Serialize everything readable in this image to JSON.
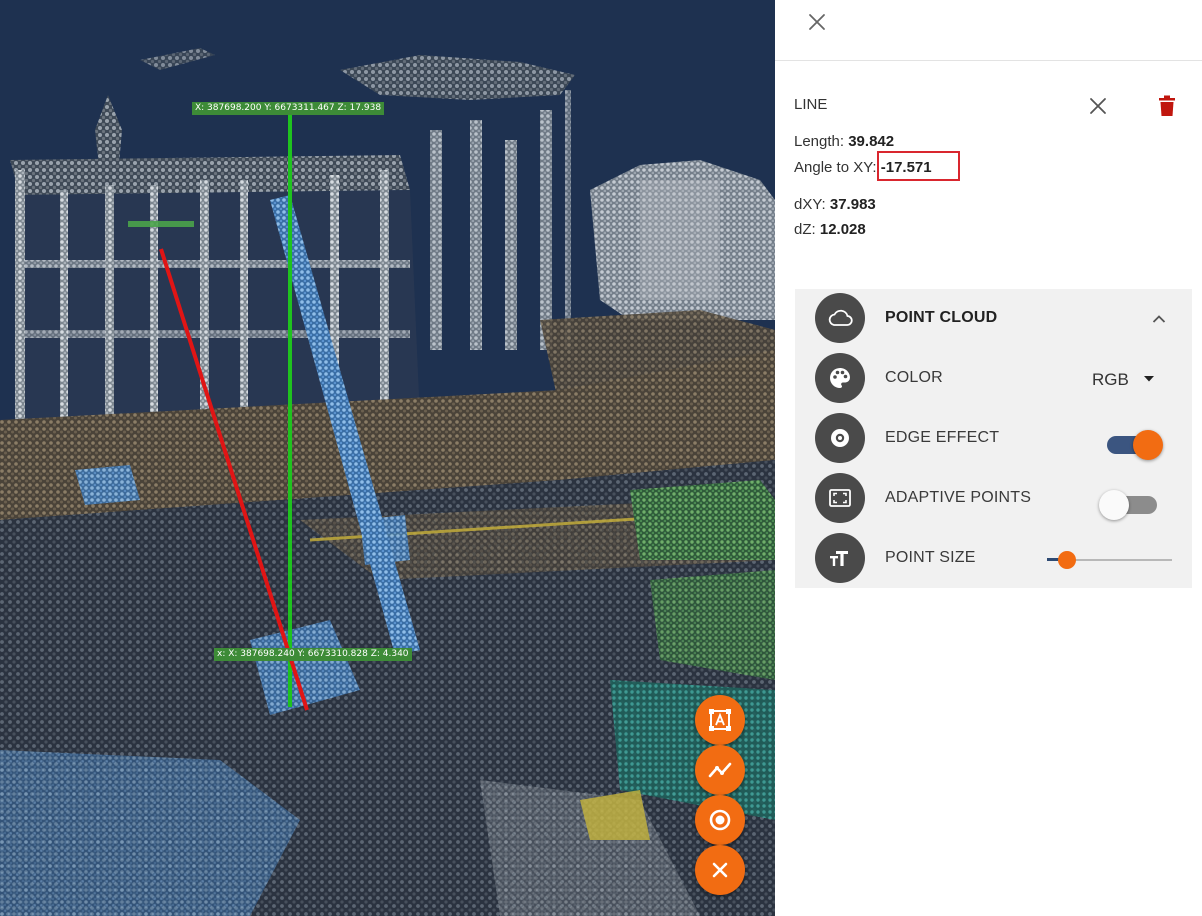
{
  "viewer": {
    "coord_labels": {
      "top": "X: 387698.200  Y: 6673311.467  Z: 17.938",
      "bottom": "x: X: 387698.240  Y: 6673310.828  Z: 4.340"
    },
    "fabs": [
      {
        "icon": "text-annotation-icon"
      },
      {
        "icon": "polyline-measure-icon"
      },
      {
        "icon": "point-target-icon"
      },
      {
        "icon": "close-icon"
      }
    ],
    "colors": {
      "background": "#1e3150",
      "fab": "#f26c12",
      "vertical_line": "#1fc21f",
      "measure_line": "#e01515"
    }
  },
  "panel": {
    "close_icon": "close-icon",
    "measurement": {
      "title": "LINE",
      "length_label": "Length:",
      "length_value": "39.842",
      "angle_label": "Angle to XY:",
      "angle_value": "-17.571",
      "dxy_label": "dXY:",
      "dxy_value": "37.983",
      "dz_label": "dZ:",
      "dz_value": "12.028",
      "delete_icon_color": "#c0160e"
    },
    "settings": {
      "section_title": "POINT CLOUD",
      "color_label": "COLOR",
      "color_value": "RGB",
      "edge_effect_label": "EDGE EFFECT",
      "edge_effect_on": true,
      "adaptive_points_label": "ADAPTIVE POINTS",
      "adaptive_points_on": false,
      "point_size_label": "POINT SIZE",
      "point_size_fraction": 0.16
    }
  }
}
